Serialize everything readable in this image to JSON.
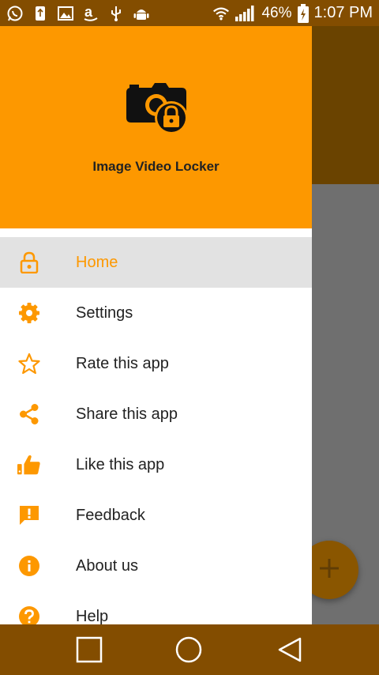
{
  "status_bar": {
    "battery_percent": "46%",
    "time": "1:07 PM",
    "left_icons": [
      "whatsapp-icon",
      "usb-icon",
      "image-icon",
      "amazon-icon",
      "usb-debug-icon",
      "android-icon"
    ],
    "right_icons": [
      "wifi-icon",
      "signal-icon",
      "battery-charging-icon"
    ]
  },
  "drawer": {
    "app_name": "Image Video Locker",
    "logo_icon": "camera-lock-icon",
    "items": [
      {
        "label": "Home",
        "icon": "lock-icon",
        "active": true
      },
      {
        "label": "Settings",
        "icon": "gear-icon",
        "active": false
      },
      {
        "label": "Rate this app",
        "icon": "star-outline-icon",
        "active": false
      },
      {
        "label": "Share this app",
        "icon": "share-icon",
        "active": false
      },
      {
        "label": "Like this app",
        "icon": "thumbs-up-icon",
        "active": false
      },
      {
        "label": "Feedback",
        "icon": "feedback-icon",
        "active": false
      },
      {
        "label": "About us",
        "icon": "info-icon",
        "active": false
      },
      {
        "label": "Help",
        "icon": "help-icon",
        "active": false
      }
    ]
  },
  "fab": {
    "icon": "plus-icon"
  },
  "nav_bar": {
    "buttons": [
      "recent-apps-icon",
      "home-circle-icon",
      "back-triangle-icon"
    ]
  },
  "colors": {
    "accent": "#fd9800",
    "status_bar": "#834d00",
    "active_item_bg": "#e2e2e2"
  }
}
